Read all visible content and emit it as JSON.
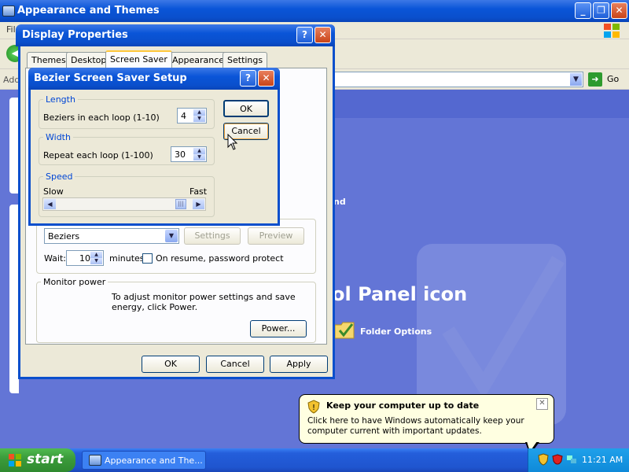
{
  "explorer": {
    "title": "Appearance and Themes",
    "menu_first": "File",
    "address_label": "Address",
    "go_label": "Go",
    "content_fragment_nd": "nd",
    "heading_fragment": "ol Panel icon",
    "folder_options": "Folder Options"
  },
  "display_properties": {
    "title": "Display Properties",
    "tabs": [
      "Themes",
      "Desktop",
      "Screen Saver",
      "Appearance",
      "Settings"
    ],
    "active_tab": "Screen Saver",
    "screensaver_select": "Beziers",
    "settings_button": "Settings",
    "preview_button": "Preview",
    "wait_label": "Wait:",
    "wait_value": "10",
    "minutes_label": "minutes",
    "password_label": "On resume, password protect",
    "monitor_power_group": "Monitor power",
    "monitor_power_text": "To adjust monitor power settings and save energy, click Power.",
    "power_button": "Power...",
    "ok": "OK",
    "cancel": "Cancel",
    "apply": "Apply"
  },
  "bezier_setup": {
    "title": "Bezier Screen Saver Setup",
    "length_group": "Length",
    "beziers_label": "Beziers in each loop (1-10)",
    "beziers_value": "4",
    "width_group": "Width",
    "repeat_label": "Repeat each loop (1-100)",
    "repeat_value": "30",
    "speed_group": "Speed",
    "slow_label": "Slow",
    "fast_label": "Fast",
    "speed_level": 0.95,
    "ok": "OK",
    "cancel": "Cancel"
  },
  "balloon": {
    "title": "Keep your computer up to date",
    "text": "Click here to have Windows automatically keep your computer current with important updates."
  },
  "taskbar": {
    "start": "start",
    "task_item": "Appearance and The...",
    "clock": "11:21 AM"
  },
  "colors": {
    "title_blue": "#0a4fcc",
    "taskbar_blue": "#245edb",
    "start_green": "#3c9c3c",
    "group_label_blue": "#0046d5"
  }
}
